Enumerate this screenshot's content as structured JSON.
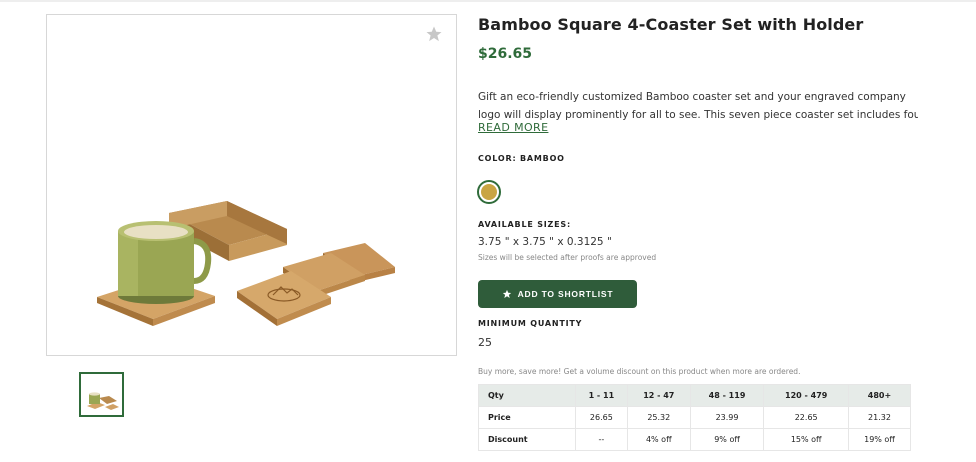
{
  "product": {
    "title": "Bamboo Square 4-Coaster Set with Holder",
    "price": "$26.65",
    "description_line1": "Gift an eco-friendly customized Bamboo coaster set and your engraved company",
    "description_line2": "logo will display prominently for all to see. This seven piece coaster set includes fou...",
    "read_more": "READ MORE"
  },
  "color": {
    "label": "COLOR: BAMBOO",
    "swatch_hex": "#c9a543"
  },
  "sizes": {
    "label": "AVAILABLE SIZES:",
    "value": "3.75 \" x 3.75 \" x 0.3125 \"",
    "note": "Sizes will be selected after proofs are approved"
  },
  "shortlist": {
    "label": "ADD TO SHORTLIST"
  },
  "minimum_quantity": {
    "label": "MINIMUM QUANTITY",
    "value": "25"
  },
  "volume": {
    "note": "Buy more, save more! Get a volume discount on this product when more are ordered."
  },
  "pricing_table": {
    "headers": [
      "Qty",
      "1 - 11",
      "12 - 47",
      "48 - 119",
      "120 - 479",
      "480+"
    ],
    "price_row": [
      "Price",
      "26.65",
      "25.32",
      "23.99",
      "22.65",
      "21.32"
    ],
    "discount_row": [
      "Discount",
      "--",
      "4% off",
      "9% off",
      "15% off",
      "19% off"
    ]
  },
  "icons": {
    "favorite": "star-icon",
    "shortlist": "star-icon"
  },
  "colors": {
    "brand_green": "#2f5c3a",
    "price_green": "#2f6b3a"
  }
}
